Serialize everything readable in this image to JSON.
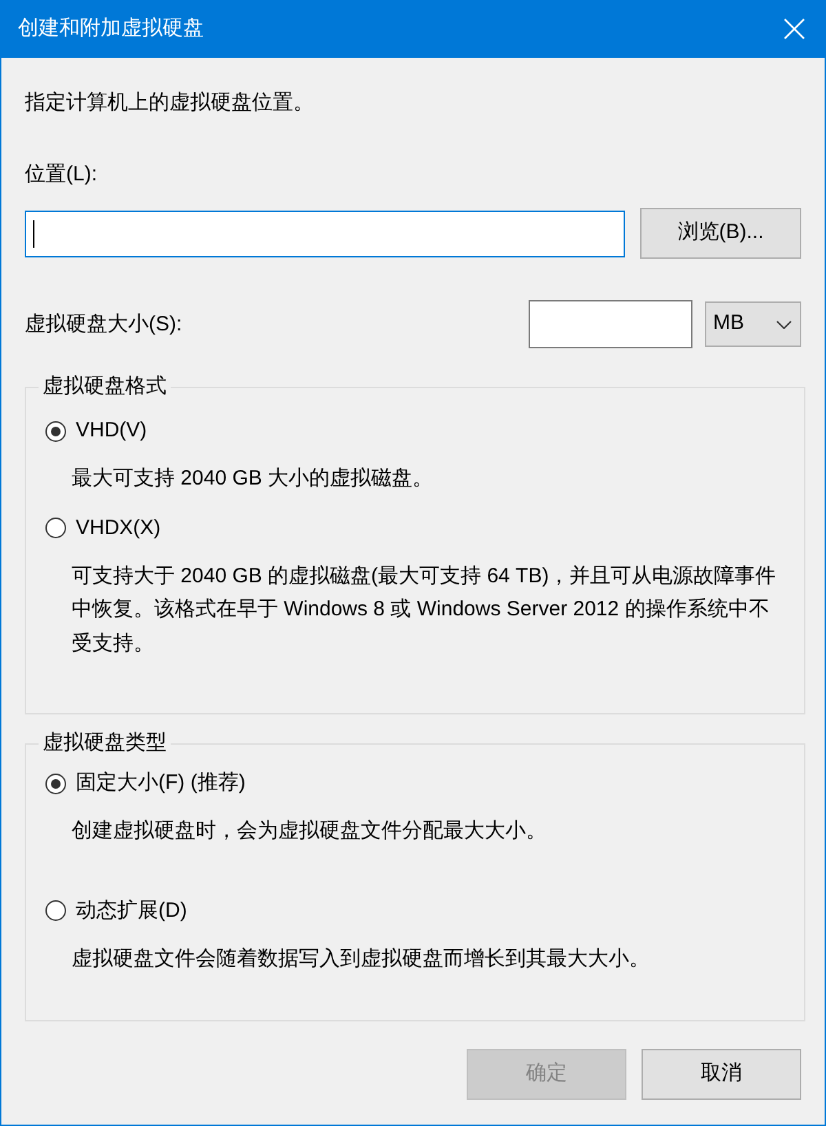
{
  "window": {
    "title": "创建和附加虚拟硬盘"
  },
  "instruction": "指定计算机上的虚拟硬盘位置。",
  "location": {
    "label": "位置(L):",
    "focused": true
  },
  "browse_button": {
    "label": "浏览(B)..."
  },
  "size": {
    "label": "虚拟硬盘大小(S):",
    "unit": "MB"
  },
  "format_group": {
    "legend": "虚拟硬盘格式",
    "options": [
      {
        "label": "VHD(V)",
        "selected": true,
        "description": "最大可支持 2040 GB 大小的虚拟磁盘。"
      },
      {
        "label": "VHDX(X)",
        "selected": false,
        "description": "可支持大于 2040 GB 的虚拟磁盘(最大可支持 64 TB)，并且可从电源故障事件中恢复。该格式在早于 Windows 8 或 Windows Server 2012 的操作系统中不受支持。"
      }
    ]
  },
  "type_group": {
    "legend": "虚拟硬盘类型",
    "options": [
      {
        "label": "固定大小(F) (推荐)",
        "selected": true,
        "description": "创建虚拟硬盘时，会为虚拟硬盘文件分配最大大小。"
      },
      {
        "label": "动态扩展(D)",
        "selected": false,
        "description": "虚拟硬盘文件会随着数据写入到虚拟硬盘而增长到其最大大小。"
      }
    ]
  },
  "buttons": [
    {
      "label": "确定",
      "disabled": true
    },
    {
      "label": "取消",
      "disabled": false
    }
  ]
}
